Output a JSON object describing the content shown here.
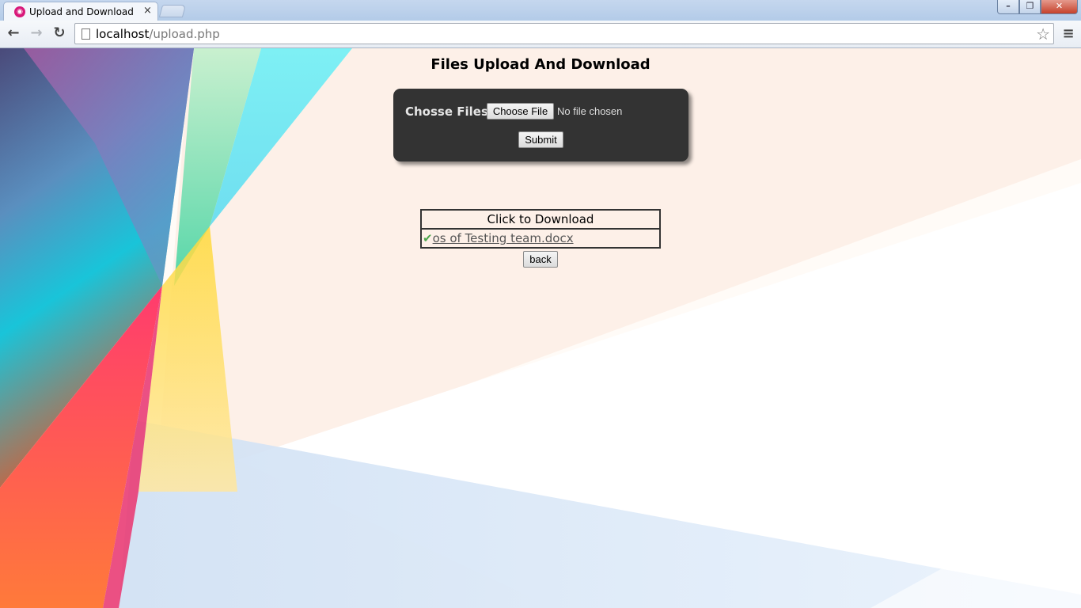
{
  "browser": {
    "tab_title": "Upload and Download",
    "tab_close": "×",
    "url_host": "localhost",
    "url_path": "/upload.php",
    "buttons": {
      "back": "←",
      "forward": "→",
      "reload": "↻",
      "star": "☆",
      "menu": "≡",
      "minimize": "–",
      "maximize": "❐",
      "close": "✕"
    }
  },
  "page": {
    "title": "Files Upload And Download",
    "upload": {
      "label": "Chosse Files",
      "choose_button": "Choose File",
      "file_status": "No file chosen",
      "submit_button": "Submit"
    },
    "downloads": {
      "header": "Click to Download",
      "files": [
        {
          "check": "✔",
          "name": "os of Testing team.docx"
        }
      ]
    },
    "back_button": "back"
  },
  "colors": {
    "upload_panel": "#333333",
    "link": "#555555",
    "check": "#4ea64e",
    "favicon": "#d8187a"
  }
}
